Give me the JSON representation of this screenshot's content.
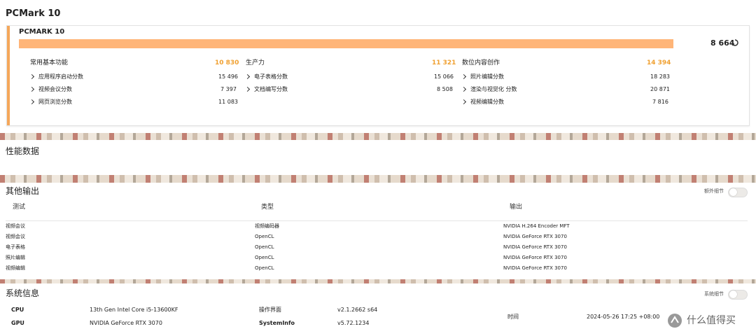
{
  "pcmark": {
    "section_title": "PCMark 10",
    "card_title": "PCMARK 10",
    "score": "8 664",
    "groups": [
      {
        "name": "常用基本功能",
        "score": "10 830",
        "items": [
          {
            "label": "应用程序启动分数",
            "value": "15 496"
          },
          {
            "label": "视频会议分数",
            "value": "7 397"
          },
          {
            "label": "网页浏览分数",
            "value": "11 083"
          }
        ]
      },
      {
        "name": "生产力",
        "score": "11 321",
        "items": [
          {
            "label": "电子表格分数",
            "value": "15 066"
          },
          {
            "label": "文档编写分数",
            "value": "8 508"
          }
        ]
      },
      {
        "name": "数位内容创作",
        "score": "14 394",
        "items": [
          {
            "label": "照片编辑分数",
            "value": "18 283"
          },
          {
            "label": "渲染与视觉化 分数",
            "value": "20 871"
          },
          {
            "label": "视频编辑分数",
            "value": "7 816"
          }
        ]
      }
    ]
  },
  "perf": {
    "title": "性能数据"
  },
  "other_output": {
    "title": "其他输出",
    "toggle_label": "额外细节",
    "headers": [
      "测试",
      "类型",
      "输出"
    ],
    "rows": [
      [
        "视频会议",
        "视频编码器",
        "NVIDIA H.264 Encoder MFT"
      ],
      [
        "视频会议",
        "OpenCL",
        "NVIDIA GeForce RTX 3070"
      ],
      [
        "电子表格",
        "OpenCL",
        "NVIDIA GeForce RTX 3070"
      ],
      [
        "照片编辑",
        "OpenCL",
        "NVIDIA GeForce RTX 3070"
      ],
      [
        "视频编辑",
        "OpenCL",
        "NVIDIA GeForce RTX 3070"
      ]
    ]
  },
  "system_info": {
    "title": "系统信息",
    "toggle_label": "系统细节",
    "cpu_label": "CPU",
    "cpu_value": "13th Gen Intel Core i5-13600KF",
    "gpu_label": "GPU",
    "gpu_value": "NVIDIA GeForce RTX 3070",
    "os_label": "操作界面",
    "os_value": "v2.1.2662 s64",
    "sysinfo_label": "SystemInfo",
    "sysinfo_value": "v5.72.1234",
    "time_label": "时间",
    "time_value": "2024-05-26 17:25 +08:00"
  },
  "watermark": {
    "text": "什么值得买"
  },
  "colors": {
    "accent": "#f5a75a",
    "bar": "#ffb578",
    "score_orange": "#f0a030"
  }
}
